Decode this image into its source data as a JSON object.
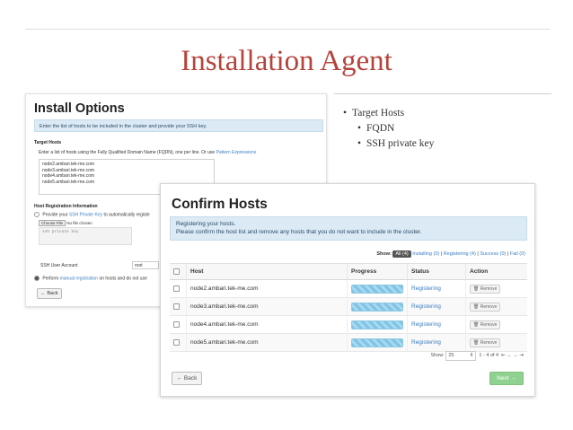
{
  "slide": {
    "title": "Installation Agent",
    "bullets": [
      {
        "text": "Target Hosts",
        "level": 1
      },
      {
        "text": "FQDN",
        "level": 2
      },
      {
        "text": "SSH private key",
        "level": 2
      }
    ]
  },
  "install_options": {
    "title": "Install Options",
    "info": "Enter the list of hosts to be included in the cluster and provide your SSH key.",
    "target_hosts_label": "Target Hosts",
    "target_hosts_help": "Enter a list of hosts using the Fully Qualified Domain Name (FQDN), one per line. Or use",
    "pattern_link": "Pattern Expressions",
    "hosts_text": [
      "node2.ambari.tek-me.com",
      "node3.ambari.tek-me.com",
      "node4.ambari.tek-me.com",
      "node5.ambari.tek-me.com"
    ],
    "host_reg_label": "Host Registration Information",
    "provide_prefix": "Provide your",
    "ssh_key_link": "SSH Private Key",
    "provide_suffix": "to automatically registe",
    "choose_file": "Choose File",
    "no_file": "No file chosen",
    "key_placeholder": "ssh private key",
    "ssh_user_label": "SSH User Account",
    "ssh_user_value": "root",
    "manual_prefix": "Perform",
    "manual_link": "manual registration",
    "manual_suffix": "on hosts and do not use",
    "back_label": "← Back"
  },
  "confirm_hosts": {
    "title": "Confirm Hosts",
    "info_line1": "Registering your hosts.",
    "info_line2": "Please confirm the host list and remove any hosts that you do not want to include in the cluster.",
    "filter": {
      "show_label": "Show:",
      "all": "All (4)",
      "installing": "Installing (0)",
      "registering": "Registering (4)",
      "success": "Success (0)",
      "fail": "Fail (0)",
      "sep": "|"
    },
    "columns": {
      "host": "Host",
      "progress": "Progress",
      "status": "Status",
      "action": "Action"
    },
    "rows": [
      {
        "host": "node2.ambari.tek-me.com",
        "status": "Registering",
        "action": "Remove",
        "progress": 1.0
      },
      {
        "host": "node3.ambari.tek-me.com",
        "status": "Registering",
        "action": "Remove",
        "progress": 1.0
      },
      {
        "host": "node4.ambari.tek-me.com",
        "status": "Registering",
        "action": "Remove",
        "progress": 1.0
      },
      {
        "host": "node5.ambari.tek-me.com",
        "status": "Registering",
        "action": "Remove",
        "progress": 1.0
      }
    ],
    "pager": {
      "show_label": "Show:",
      "page_size": "25",
      "range": "1 - 4 of 4"
    },
    "back_label": "← Back",
    "next_label": "Next →"
  }
}
